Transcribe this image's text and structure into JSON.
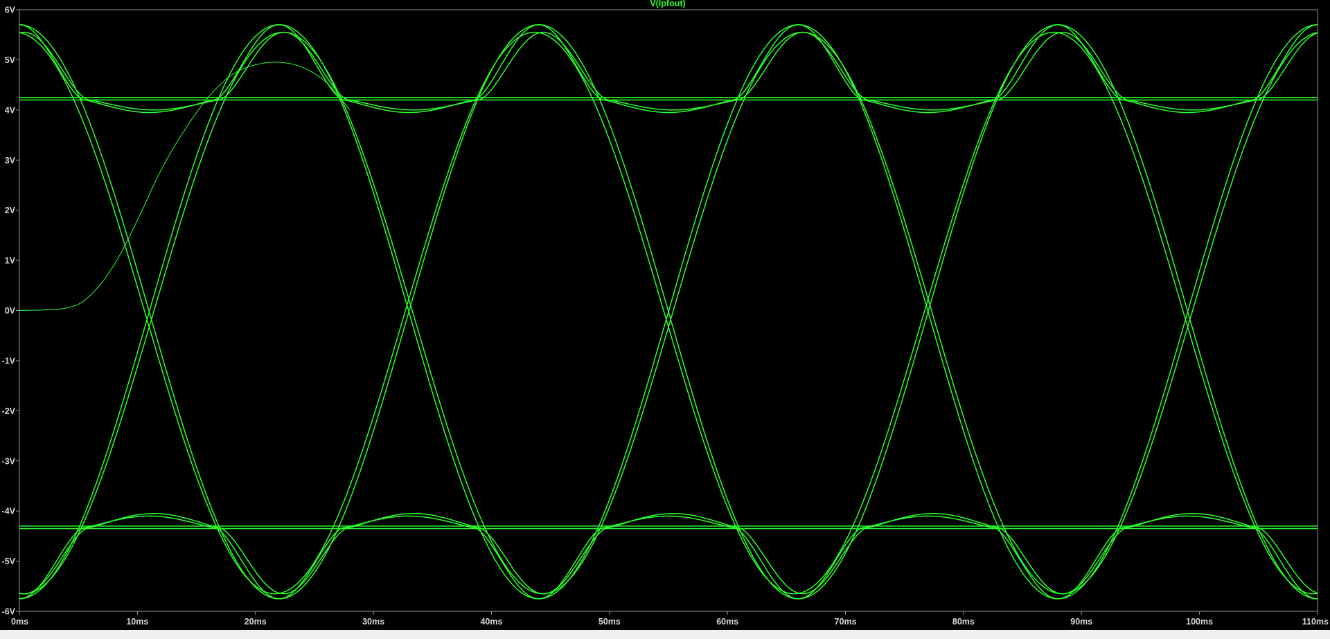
{
  "window": {
    "trace_title": "V(lpfout)"
  },
  "colors": {
    "background": "#000000",
    "trace": "#2bff2b",
    "axis": "#9a9a9a",
    "label": "#d8d8d8"
  },
  "chart_data": {
    "type": "line",
    "title": "V(lpfout)",
    "xlabel": "",
    "ylabel": "",
    "xlim": [
      0,
      110
    ],
    "ylim": [
      -6,
      6
    ],
    "x_unit": "ms",
    "y_unit": "V",
    "grid": false,
    "x_ticks": [
      "0ms",
      "10ms",
      "20ms",
      "30ms",
      "40ms",
      "50ms",
      "60ms",
      "70ms",
      "80ms",
      "90ms",
      "100ms",
      "110ms"
    ],
    "y_ticks": [
      "6V",
      "5V",
      "4V",
      "3V",
      "2V",
      "1V",
      "0V",
      "-1V",
      "-2V",
      "-3V",
      "-4V",
      "-5V",
      "-6V"
    ],
    "eye_overlay": {
      "description_values": {
        "bit_period_ms": 22,
        "first_crossing_ms": 11,
        "crossing_voltage": 0,
        "peak_voltage": 5.7,
        "trough_voltage": -5.75,
        "upper_flat_level": 4.2,
        "lower_flat_level": -4.33,
        "startup_peak_voltage": 4.95
      },
      "upper_flat_lines": [
        4.25,
        4.2
      ],
      "lower_flat_lines": [
        -4.3,
        -4.35
      ],
      "upper_bumps": [
        {
          "peak": 5.7,
          "shoulder": 3.95
        },
        {
          "peak": 5.55,
          "shoulder": 4.0
        }
      ],
      "lower_bumps": [
        {
          "trough": -5.75,
          "shoulder": -4.1
        },
        {
          "trough": -5.65,
          "shoulder": -4.05
        }
      ],
      "startup_trace": [
        {
          "x": 0,
          "y": 0
        },
        {
          "x": 4,
          "y": 0.05
        },
        {
          "x": 6,
          "y": 0.3
        },
        {
          "x": 8,
          "y": 0.9
        },
        {
          "x": 10,
          "y": 1.8
        },
        {
          "x": 12,
          "y": 2.8
        },
        {
          "x": 14,
          "y": 3.6
        },
        {
          "x": 16,
          "y": 4.25
        },
        {
          "x": 18,
          "y": 4.7
        },
        {
          "x": 20,
          "y": 4.9
        },
        {
          "x": 22,
          "y": 4.95
        },
        {
          "x": 24,
          "y": 4.85
        },
        {
          "x": 26,
          "y": 4.55
        },
        {
          "x": 28,
          "y": 4.0
        }
      ]
    }
  }
}
